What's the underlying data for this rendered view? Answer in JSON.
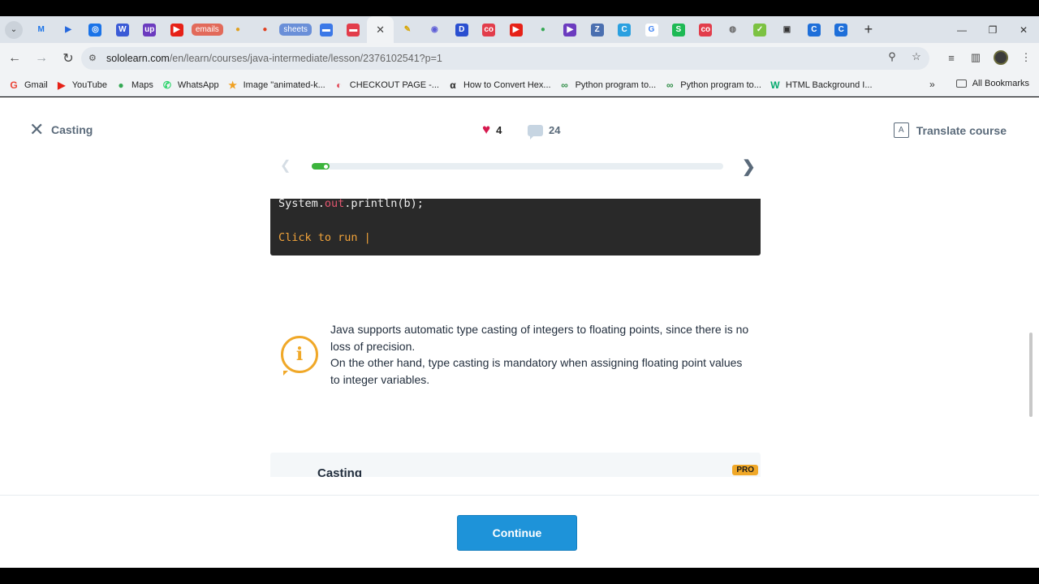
{
  "browser": {
    "tabs": [
      {
        "name": "gmail-m",
        "label": "M",
        "bg": "transparent",
        "fg": "#1a73e8"
      },
      {
        "name": "play",
        "label": "▶",
        "bg": "transparent",
        "fg": "#2266dd"
      },
      {
        "name": "chrome-c",
        "label": "◎",
        "bg": "#1a73e8",
        "fg": "#fff"
      },
      {
        "name": "word",
        "label": "W",
        "bg": "#3b5bd6",
        "fg": "#fff"
      },
      {
        "name": "upwork",
        "label": "up",
        "bg": "#6b3bbf",
        "fg": "#fff"
      },
      {
        "name": "youtube",
        "label": "▶",
        "bg": "#e62117",
        "fg": "#fff"
      },
      {
        "name": "emails-group",
        "label": "emails",
        "group": true,
        "bg": "#e26a5a"
      },
      {
        "name": "maps-1",
        "label": "●",
        "bg": "transparent",
        "fg": "#e0a020"
      },
      {
        "name": "maps-2",
        "label": "●",
        "bg": "transparent",
        "fg": "#e04020"
      },
      {
        "name": "sheets-group",
        "label": "sheets",
        "group": true,
        "bg": "#6a8fd8"
      },
      {
        "name": "docs",
        "label": "▬",
        "bg": "#3b78e7",
        "fg": "#fff"
      },
      {
        "name": "red-doc",
        "label": "▬",
        "bg": "#e23d4b",
        "fg": "#fff"
      },
      {
        "name": "active-tab",
        "label": "✕",
        "active": true
      },
      {
        "name": "pencil",
        "label": "✎",
        "bg": "transparent",
        "fg": "#d8a400"
      },
      {
        "name": "edge",
        "label": "◉",
        "bg": "transparent",
        "fg": "#5b5bd6"
      },
      {
        "name": "d-app",
        "label": "D",
        "bg": "#2a4fd0",
        "fg": "#fff"
      },
      {
        "name": "sololearn-1",
        "label": "co",
        "bg": "#e23d4b",
        "fg": "#fff"
      },
      {
        "name": "youtube-2",
        "label": "▶",
        "bg": "#e62117",
        "fg": "#fff"
      },
      {
        "name": "maps-3",
        "label": "●",
        "bg": "transparent",
        "fg": "#34a853"
      },
      {
        "name": "meet",
        "label": "▶",
        "bg": "#6b3bbf",
        "fg": "#fff"
      },
      {
        "name": "notes",
        "label": "Z",
        "bg": "#4a6fb0",
        "fg": "#fff"
      },
      {
        "name": "copilot",
        "label": "C",
        "bg": "#2aa0e0",
        "fg": "#fff"
      },
      {
        "name": "google",
        "label": "G",
        "bg": "#ffffff",
        "fg": "#4285f4"
      },
      {
        "name": "s-app",
        "label": "S",
        "bg": "#1db954",
        "fg": "#fff"
      },
      {
        "name": "sololearn-2",
        "label": "co",
        "bg": "#e23d4b",
        "fg": "#fff"
      },
      {
        "name": "globe",
        "label": "◍",
        "bg": "transparent",
        "fg": "#666"
      },
      {
        "name": "green-app",
        "label": "✓",
        "bg": "#7cc242",
        "fg": "#fff"
      },
      {
        "name": "window-app",
        "label": "▣",
        "bg": "transparent",
        "fg": "#333"
      },
      {
        "name": "c-app-1",
        "label": "C",
        "bg": "#1e6fd9",
        "fg": "#fff"
      },
      {
        "name": "c-app-2",
        "label": "C",
        "bg": "#1e6fd9",
        "fg": "#fff"
      }
    ],
    "new_tab": "+",
    "url_domain": "sololearn.com",
    "url_path": "/en/learn/courses/java-intermediate/lesson/2376102541?p=1",
    "bookmarks": [
      {
        "name": "gmail",
        "label": "Gmail",
        "icon": "G",
        "color": "#ea4335"
      },
      {
        "name": "youtube",
        "label": "YouTube",
        "icon": "▶",
        "color": "#e62117"
      },
      {
        "name": "maps",
        "label": "Maps",
        "icon": "●",
        "color": "#34a853"
      },
      {
        "name": "whatsapp",
        "label": "WhatsApp",
        "icon": "✆",
        "color": "#25d366"
      },
      {
        "name": "image-animated",
        "label": "Image \"animated-k...",
        "icon": "★",
        "color": "#f0a020"
      },
      {
        "name": "checkout",
        "label": "CHECKOUT PAGE -...",
        "icon": "◐",
        "color": "#e04050"
      },
      {
        "name": "convert-hex",
        "label": "How to Convert Hex...",
        "icon": "α",
        "color": "#222"
      },
      {
        "name": "python-1",
        "label": "Python program to...",
        "icon": "∞",
        "color": "#2f8d46"
      },
      {
        "name": "python-2",
        "label": "Python program to...",
        "icon": "∞",
        "color": "#2f8d46"
      },
      {
        "name": "html-bg",
        "label": "HTML Background I...",
        "icon": "W",
        "color": "#04aa6d"
      }
    ],
    "all_bookmarks": "All Bookmarks"
  },
  "lesson": {
    "title": "Casting",
    "likes": "4",
    "comments": "24",
    "translate": "Translate course",
    "progress_fraction": 0.04
  },
  "code": {
    "line_prefix": "System.",
    "line_kw": "out",
    "line_suffix": ".println(b);",
    "run": "Click to run |"
  },
  "info": {
    "line1": "Java supports automatic type casting of integers to floating points, since there is no loss of precision.",
    "line2": "On the other hand, type casting is mandatory when assigning floating point values to integer variables."
  },
  "pro_card": {
    "title": "Casting",
    "badge": "PRO"
  },
  "footer": {
    "continue": "Continue"
  }
}
